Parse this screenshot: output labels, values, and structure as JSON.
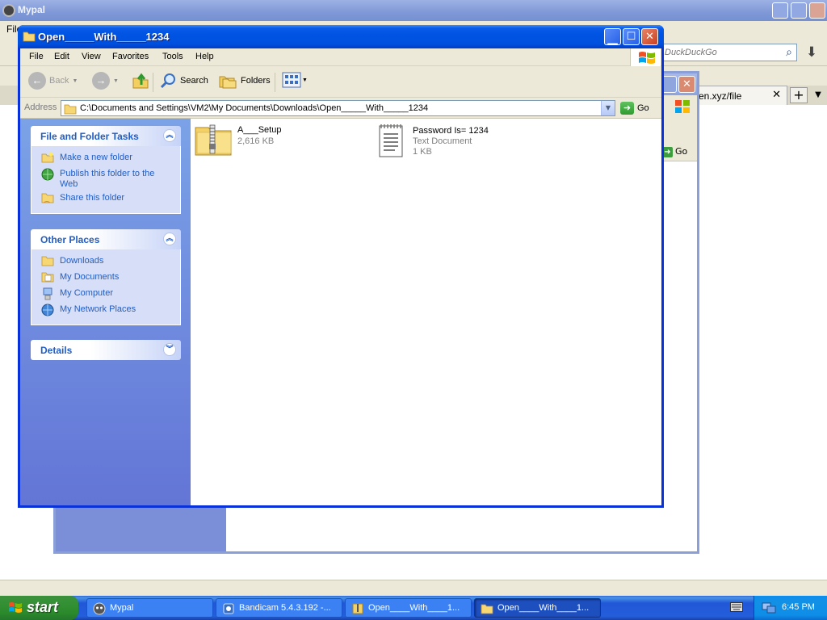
{
  "background_browser": {
    "title": "Mypal",
    "menu_first": "File",
    "search_placeholder": "DuckDuckGo",
    "tab_label": "en.xyz/file"
  },
  "background_window": {
    "go_label": "Go"
  },
  "window": {
    "title": "Open_____With_____1234",
    "menu": [
      "File",
      "Edit",
      "View",
      "Favorites",
      "Tools",
      "Help"
    ],
    "toolbar": {
      "back": "Back",
      "search": "Search",
      "folders": "Folders"
    },
    "address_label": "Address",
    "address_value": "C:\\Documents and Settings\\VM2\\My Documents\\Downloads\\Open_____With_____1234",
    "go_label": "Go",
    "panels": {
      "file_tasks": {
        "title": "File and Folder Tasks",
        "items": [
          "Make a new folder",
          "Publish this folder to the Web",
          "Share this folder"
        ]
      },
      "other_places": {
        "title": "Other Places",
        "items": [
          "Downloads",
          "My Documents",
          "My Computer",
          "My Network Places"
        ]
      },
      "details": {
        "title": "Details"
      }
    },
    "files": [
      {
        "name": "A___Setup",
        "line2": "2,616 KB",
        "line3": "",
        "icon": "zip-folder-icon"
      },
      {
        "name": "Password Is= 1234",
        "line2": "Text Document",
        "line3": "1 KB",
        "icon": "text-document-icon"
      }
    ]
  },
  "taskbar": {
    "start_label": "start",
    "buttons": [
      {
        "label": "Mypal",
        "icon": "mypal-icon",
        "active": false
      },
      {
        "label": "Bandicam 5.4.3.192 -...",
        "icon": "bandicam-icon",
        "active": false
      },
      {
        "label": "Open____With____1...",
        "icon": "archive-icon",
        "active": false
      },
      {
        "label": "Open____With____1...",
        "icon": "folder-icon",
        "active": true
      }
    ],
    "clock": "6:45 PM"
  }
}
